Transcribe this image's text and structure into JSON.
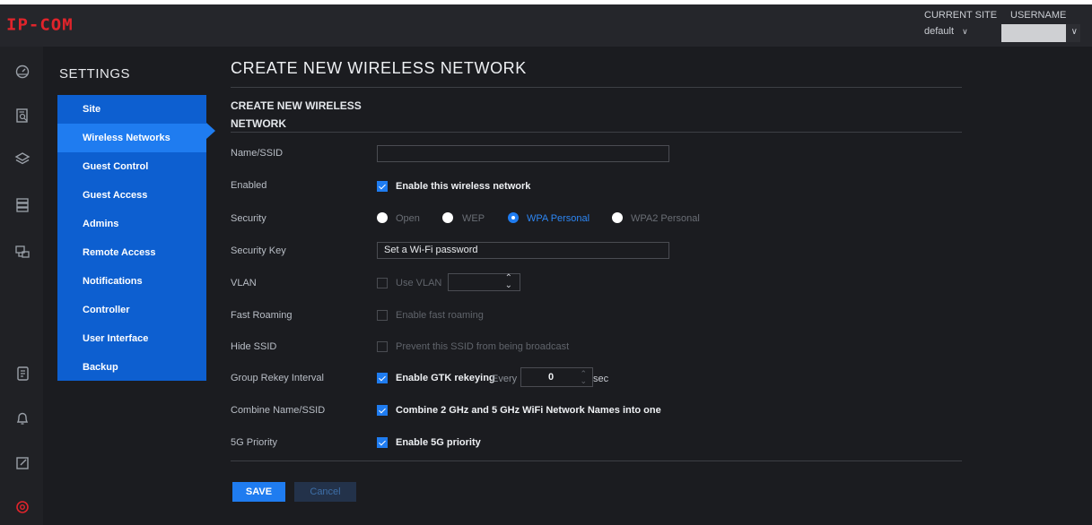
{
  "header": {
    "logo": "IP-COM",
    "current_site_label": "CURRENT SITE",
    "current_site_value": "default",
    "username_label": "USERNAME",
    "chevron": "chevron-down-icon"
  },
  "rail": {
    "icons": [
      "dashboard-icon",
      "stats-icon",
      "layers-icon",
      "devices-icon",
      "topology-icon",
      "log-icon",
      "bell-icon",
      "edit-icon",
      "settings-icon"
    ]
  },
  "settings": {
    "title": "SETTINGS",
    "menu": [
      {
        "label": "Site"
      },
      {
        "label": "Wireless Networks"
      },
      {
        "label": "Guest Control"
      },
      {
        "label": "Guest Access"
      },
      {
        "label": "Admins"
      },
      {
        "label": "Remote Access"
      },
      {
        "label": "Notifications"
      },
      {
        "label": "Controller"
      },
      {
        "label": "User Interface"
      },
      {
        "label": "Backup"
      }
    ],
    "active_item": "Wireless Networks"
  },
  "form": {
    "page_title": "CREATE NEW WIRELESS NETWORK",
    "section_title": "CREATE NEW WIRELESS NETWORK",
    "ssid": {
      "label": "Name/SSID",
      "value": ""
    },
    "enabled": {
      "label": "Enabled",
      "checkbox": "Enable this wireless network",
      "checked": true
    },
    "security": {
      "label": "Security",
      "options": [
        "Open",
        "WEP",
        "WPA Personal",
        "WPA2 Personal"
      ],
      "selected": "WPA Personal"
    },
    "security_key": {
      "label": "Security Key",
      "placeholder": "Set a Wi-Fi password"
    },
    "vlan": {
      "label": "VLAN",
      "checkbox": "Use VLAN",
      "checked": false,
      "value": ""
    },
    "fast_roaming": {
      "label": "Fast Roaming",
      "checkbox": "Enable fast roaming",
      "checked": false
    },
    "hide_ssid": {
      "label": "Hide SSID",
      "checkbox": "Prevent this SSID from being broadcast",
      "checked": false
    },
    "group_rekey": {
      "label": "Group Rekey Interval",
      "checkbox": "Enable GTK rekeying",
      "checked": true,
      "every_label": "Every",
      "value": "0",
      "unit": "sec"
    },
    "combine_ssid": {
      "label": "Combine Name/SSID",
      "checkbox": "Combine 2 GHz and 5 GHz WiFi Network Names into one",
      "checked": true
    },
    "priority_5g": {
      "label": "5G Priority",
      "checkbox": "Enable 5G priority",
      "checked": true
    },
    "save_label": "SAVE",
    "cancel_label": "Cancel"
  },
  "colors": {
    "accent": "#1f7cf0",
    "menu_bg": "#0d5fd0",
    "logo": "#e0242b",
    "background": "#1b1c20"
  }
}
